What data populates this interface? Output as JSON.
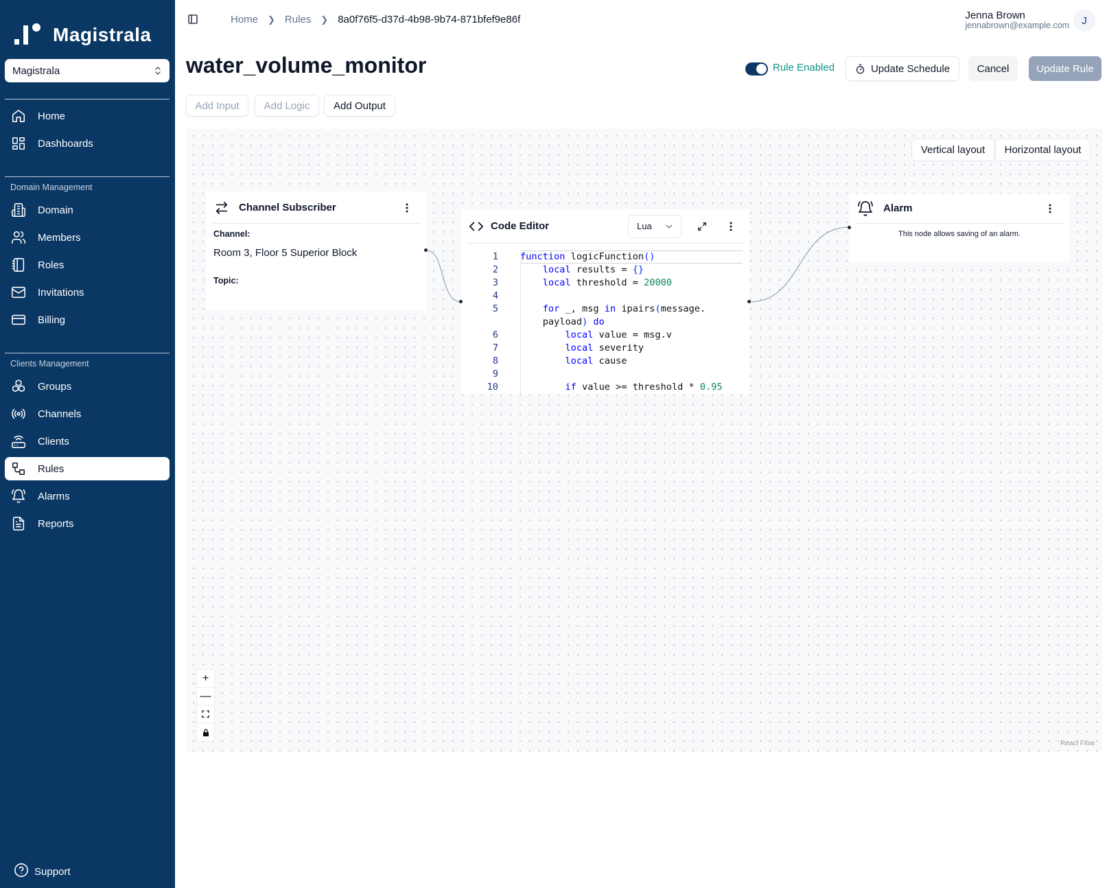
{
  "app": {
    "brand": "Magistrala",
    "domain_selector": "Magistrala"
  },
  "sidebar": {
    "top_items": [
      {
        "label": "Home",
        "icon": "home-icon"
      },
      {
        "label": "Dashboards",
        "icon": "dashboards-icon"
      }
    ],
    "domain_section": {
      "title": "Domain Management",
      "items": [
        {
          "label": "Domain",
          "icon": "domain-icon"
        },
        {
          "label": "Members",
          "icon": "members-icon"
        },
        {
          "label": "Roles",
          "icon": "roles-icon"
        },
        {
          "label": "Invitations",
          "icon": "invitations-icon"
        },
        {
          "label": "Billing",
          "icon": "billing-icon"
        }
      ]
    },
    "clients_section": {
      "title": "Clients Management",
      "items": [
        {
          "label": "Groups",
          "icon": "groups-icon"
        },
        {
          "label": "Channels",
          "icon": "channels-icon"
        },
        {
          "label": "Clients",
          "icon": "clients-icon"
        },
        {
          "label": "Rules",
          "icon": "rules-icon",
          "active": true
        },
        {
          "label": "Alarms",
          "icon": "alarms-icon"
        },
        {
          "label": "Reports",
          "icon": "reports-icon"
        }
      ]
    },
    "support_label": "Support"
  },
  "header": {
    "breadcrumb": [
      "Home",
      "Rules",
      "8a0f76f5-d37d-4b98-9b74-871bfef9e86f"
    ],
    "user_name": "Jenna Brown",
    "user_email": "jennabrown@example.com",
    "avatar_initial": "J"
  },
  "page": {
    "title": "water_volume_monitor",
    "rule_enabled_label": "Rule Enabled",
    "rule_enabled": true,
    "update_schedule_label": "Update Schedule",
    "cancel_label": "Cancel",
    "update_rule_label": "Update Rule",
    "add_input_label": "Add Input",
    "add_logic_label": "Add Logic",
    "add_output_label": "Add Output"
  },
  "canvas": {
    "vertical_layout_label": "Vertical layout",
    "horizontal_layout_label": "Horizontal layout",
    "attribution": "React Flow",
    "zoom_in": "+",
    "zoom_out": "—"
  },
  "nodes": {
    "channel_subscriber": {
      "title": "Channel Subscriber",
      "channel_label": "Channel:",
      "channel_value": "Room 3, Floor 5 Superior Block",
      "topic_label": "Topic:"
    },
    "code_editor": {
      "title": "Code Editor",
      "language": "Lua",
      "lines": [
        {
          "n": "1",
          "text": "function logicFunction()"
        },
        {
          "n": "2",
          "text": "    local results = {}"
        },
        {
          "n": "3",
          "text": "    local threshold = 20000"
        },
        {
          "n": "4",
          "text": ""
        },
        {
          "n": "5",
          "text": "    for _, msg in ipairs(message."
        },
        {
          "n": "",
          "text": "    payload) do"
        },
        {
          "n": "6",
          "text": "        local value = msg.v"
        },
        {
          "n": "7",
          "text": "        local severity"
        },
        {
          "n": "8",
          "text": "        local cause"
        },
        {
          "n": "9",
          "text": ""
        },
        {
          "n": "10",
          "text": "        if value >= threshold * 0.95"
        }
      ]
    },
    "alarm": {
      "title": "Alarm",
      "description": "This node allows saving of an alarm."
    }
  },
  "colors": {
    "sidebar_bg": "#0a3764",
    "accent_teal": "#0d9488",
    "disabled_primary": "#94a3b8"
  }
}
